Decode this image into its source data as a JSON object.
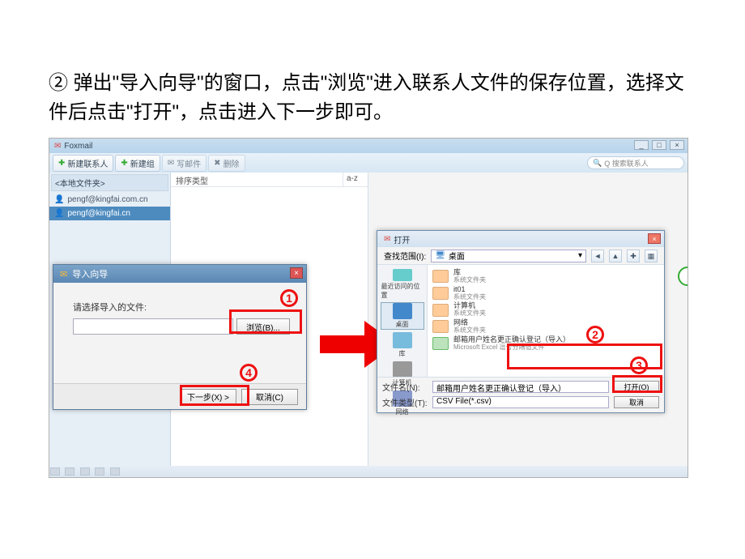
{
  "instruction": "② 弹出\"导入向导\"的窗口，点击\"浏览\"进入联系人文件的保存位置，选择文件后点击\"打开\"，点击进入下一步即可。",
  "foxmail": {
    "title": "Foxmail",
    "toolbar": {
      "new_contact": "新建联系人",
      "new_group": "新建组",
      "mail": "写邮件",
      "delete": "删除"
    },
    "search": {
      "placeholder": "Q 搜索联系人"
    },
    "left": {
      "header": "<本地文件夹>",
      "item1": "pengf@kingfai.com.cn",
      "item2": "pengf@kingfai.cn"
    },
    "mid": {
      "sort": "排序类型",
      "az": "a-z"
    }
  },
  "callouts": {
    "one": "1",
    "two": "2",
    "three": "3",
    "four": "4"
  },
  "wizard": {
    "title": "导入向导",
    "label": "请选择导入的文件:",
    "browse": "浏览(B)...",
    "next": "下一步(X) >",
    "cancel": "取消(C)",
    "close": "×"
  },
  "opendlg": {
    "title": "打开",
    "close": "×",
    "lookin_label": "查找范围(I):",
    "lookin_value": "桌面",
    "places": {
      "recent": "最近访问的位置",
      "desktop": "桌面",
      "library": "库",
      "computer": "计算机",
      "network": "网络"
    },
    "files": {
      "lib": {
        "name": "库",
        "sub": "系统文件夹"
      },
      "it01": {
        "name": "it01",
        "sub": "系统文件夹"
      },
      "computer": {
        "name": "计算机",
        "sub": "系统文件夹"
      },
      "network": {
        "name": "网络",
        "sub": "系统文件夹"
      },
      "xls": {
        "name": "邮箱用户姓名更正确认登记（导入）",
        "sub": "Microsoft Excel 逗号分隔值文件"
      }
    },
    "filename_label": "文件名(N):",
    "filename_value": "邮箱用户姓名更正确认登记（导入）",
    "filetype_label": "文件类型(T):",
    "filetype_value": "CSV File(*.csv)",
    "open_btn": "打开(O)",
    "cancel_btn": "取消"
  }
}
